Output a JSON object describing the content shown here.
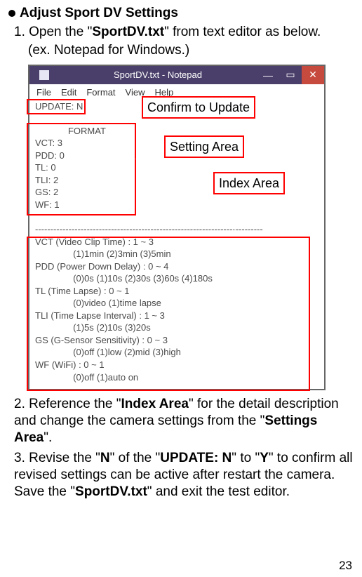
{
  "heading": "Adjust Sport DV Settings",
  "step1_pre": "1. Open the \"",
  "step1_bold": "SportDV.txt",
  "step1_post": "\" from text editor as below.",
  "step1_sub": "(ex. Notepad for Windows.)",
  "notepad": {
    "title": "SportDV.txt - Notepad",
    "menu": {
      "file": "File",
      "edit": "Edit",
      "format": "Format",
      "view": "View",
      "help": "Help"
    },
    "update_line": "UPDATE: N",
    "format_header": "FORMAT",
    "settings": [
      "VCT: 3",
      "PDD: 0",
      "TL: 0",
      "TLI: 2",
      "GS: 2",
      "WF: 1"
    ],
    "sep": "---------------------------------------------------------------------------",
    "index": [
      "VCT (Video Clip Time) : 1 ~ 3",
      "               (1)1min (2)3min (3)5min",
      "PDD (Power Down Delay) : 0 ~ 4",
      "               (0)0s (1)10s (2)30s (3)60s (4)180s",
      "TL (Time Lapse) : 0 ~ 1",
      "               (0)video (1)time lapse",
      "TLI (Time Lapse Interval) : 1 ~ 3",
      "               (1)5s (2)10s (3)20s",
      "GS (G-Sensor Sensitivity) : 0 ~ 3",
      "               (0)off (1)low (2)mid (3)high",
      "WF (WiFi) : 0 ~ 1",
      "               (0)off (1)auto on"
    ]
  },
  "annotations": {
    "confirm": "Confirm to Update",
    "setting": "Setting Area",
    "index": "Index Area"
  },
  "step2_pre": "2. Reference the \"",
  "step2_b1": "Index Area",
  "step2_mid": "\" for the detail description and change the camera settings from the \"",
  "step2_b2": "Settings Area",
  "step2_post": "\".",
  "step3_pre": "3. Revise the \"",
  "step3_b1": "N",
  "step3_m1": "\" of the \"",
  "step3_b2": "UPDATE: N",
  "step3_m2": "\" to \"",
  "step3_b3": "Y",
  "step3_m3": "\" to confirm all revised settings can be active after restart the camera.    Save the \"",
  "step3_b4": "SportDV.txt",
  "step3_post": "\" and exit the test editor.",
  "page_num": "23"
}
